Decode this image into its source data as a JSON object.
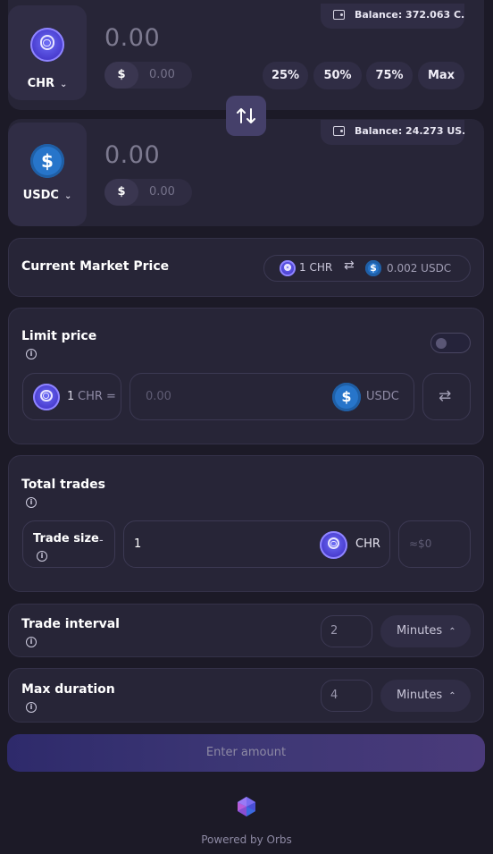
{
  "from_token": {
    "symbol": "CHR",
    "amount": "0.00",
    "usd_sign": "$",
    "usd_value": "0.00",
    "balance": "Balance: 372.063 C..."
  },
  "percent_buttons": [
    "25%",
    "50%",
    "75%",
    "Max"
  ],
  "to_token": {
    "symbol": "USDC",
    "amount": "0.00",
    "usd_sign": "$",
    "usd_value": "0.00",
    "balance": "Balance: 24.273 US..."
  },
  "market_price": {
    "label": "Current Market Price",
    "from": "1 CHR",
    "to": "0.002 USDC"
  },
  "limit_price": {
    "label": "Limit price",
    "base_amount": "1",
    "base_symbol": "CHR =",
    "input_placeholder": "0.00",
    "quote_symbol": "USDC",
    "toggle_on": false
  },
  "total_trades": {
    "label": "Total trades",
    "trade_size_label": "Trade size",
    "dash": "-",
    "amount": "1",
    "token": "CHR",
    "usd_estimate": "≈$0"
  },
  "trade_interval": {
    "label": "Trade interval",
    "value": "2",
    "unit": "Minutes"
  },
  "max_duration": {
    "label": "Max duration",
    "value": "4",
    "unit": "Minutes"
  },
  "submit": {
    "label": "Enter amount"
  },
  "footer": {
    "powered_by": "Powered by Orbs"
  },
  "colors": {
    "background": "#1c1a27",
    "card": "#272537",
    "button_gradient_start": "#2e2a6b",
    "button_gradient_end": "#4a3a7a",
    "chr_brand": "#4b3fd1",
    "usdc_brand": "#2775ca"
  }
}
